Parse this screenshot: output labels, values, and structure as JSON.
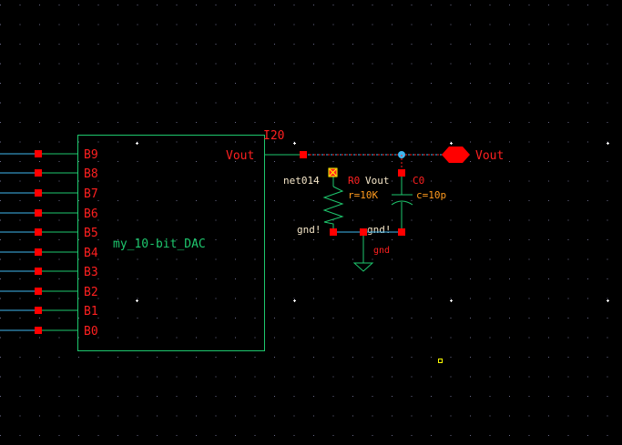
{
  "colors": {
    "background": "#000000",
    "wire": "#3fb7f0",
    "symbol": "#1ec86e",
    "pin": "#ff0000",
    "label_red": "#ff2020",
    "param": "#ff9a1e",
    "netname": "#f5e6c8",
    "grid": "#6a6a8a"
  },
  "instance": {
    "name": "I20",
    "cell": "my_10-bit_DAC",
    "output_pin": "Vout",
    "input_pins": [
      "B9",
      "B8",
      "B7",
      "B6",
      "B5",
      "B4",
      "B3",
      "B2",
      "B1",
      "B0"
    ]
  },
  "resistor": {
    "name": "R0",
    "net_top": "net014",
    "net_label": "Vout",
    "param": "r=10K",
    "bottom_net": "gnd!"
  },
  "capacitor": {
    "name": "C0",
    "param": "c=10p",
    "bottom_net": "gnd!"
  },
  "ground": {
    "label": "gnd"
  },
  "output_pin": {
    "label": "Vout"
  }
}
